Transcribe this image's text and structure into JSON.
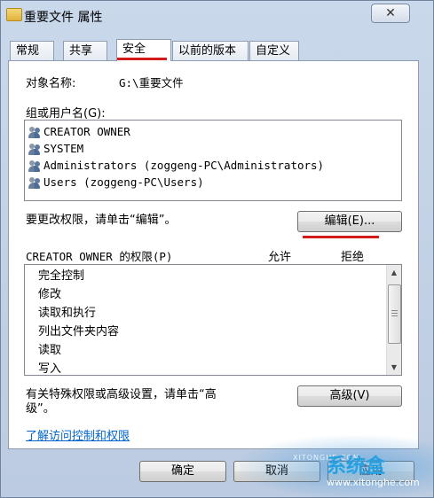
{
  "window": {
    "title": "重要文件 属性",
    "close_label": "✕"
  },
  "tabs": [
    {
      "label": "常规"
    },
    {
      "label": "共享"
    },
    {
      "label": "安全"
    },
    {
      "label": "以前的版本"
    },
    {
      "label": "自定义"
    }
  ],
  "object": {
    "label": "对象名称:",
    "value": "G:\\重要文件"
  },
  "groups": {
    "label": "组或用户名(G):",
    "items": [
      "CREATOR OWNER",
      "SYSTEM",
      "Administrators (zoggeng-PC\\Administrators)",
      "Users (zoggeng-PC\\Users)"
    ]
  },
  "change_hint": "要更改权限，请单击“编辑”。",
  "edit_button": "编辑(E)...",
  "permissions": {
    "header": "CREATOR OWNER 的权限(P)",
    "allow_label": "允许",
    "deny_label": "拒绝",
    "items": [
      "完全控制",
      "修改",
      "读取和执行",
      "列出文件夹内容",
      "读取",
      "写入"
    ]
  },
  "advanced_hint_line1": "有关特殊权限或高级设置，请单击“高",
  "advanced_hint_line2": "级”。",
  "advanced_button": "高级(V)",
  "learn_link": "了解访问控制和权限",
  "footer": {
    "ok": "确定",
    "cancel": "取消",
    "apply": "应用"
  },
  "watermark": {
    "brand": "系统盒",
    "sub": "XITONGHE.COM",
    "url": "www.xitonghe.com"
  }
}
